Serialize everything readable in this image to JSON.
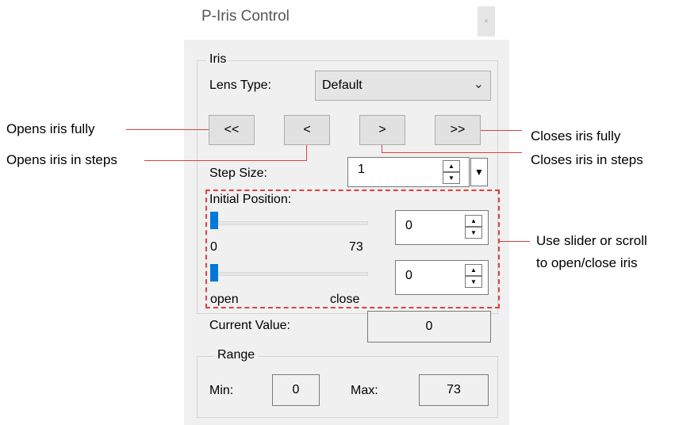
{
  "window": {
    "title": "P-Iris Control",
    "close_glyph": "×"
  },
  "iris_group": {
    "label": "Iris",
    "lens_type_label": "Lens Type:",
    "lens_type_value": "Default",
    "buttons": {
      "open_fully": "<<",
      "open_step": "<",
      "close_step": ">",
      "close_fully": ">>"
    },
    "step_size_label": "Step Size:",
    "step_size_value": "1",
    "initial_position_label": "Initial Position:",
    "slider1": {
      "min_label": "0",
      "max_label": "73",
      "level": 0,
      "value": "0"
    },
    "slider2": {
      "min_label": "open",
      "max_label": "close",
      "level": 0,
      "value": "0"
    },
    "current_value_label": "Current Value:",
    "current_value": "0"
  },
  "range_group": {
    "label": "Range",
    "min_label": "Min:",
    "min_value": "0",
    "max_label": "Max:",
    "max_value": "73"
  },
  "annotations": {
    "open_fully": "Opens iris fully",
    "open_steps": "Opens iris in steps",
    "close_fully": "Closes iris fully",
    "close_steps": "Closes iris in steps",
    "slider_line1": "Use slider or scroll",
    "slider_line2": "to open/close iris"
  },
  "colors": {
    "annotation_red": "#e04040",
    "slider_thumb": "#0078d7"
  },
  "icons": {
    "combo_arrow": "chevron-down-icon",
    "spin_up": "triangle-up-icon",
    "spin_down": "triangle-down-icon",
    "drop": "triangle-down-icon"
  }
}
